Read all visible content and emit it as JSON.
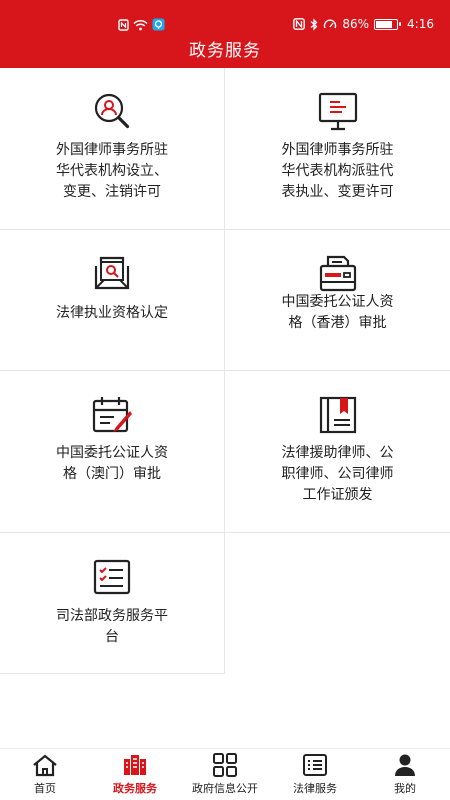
{
  "status_bar": {
    "battery": "86%",
    "time": "4:16",
    "battery_level": 0.86
  },
  "header": {
    "title": "政务服务"
  },
  "services": [
    {
      "label": "外国律师事务所驻\n华代表机构设立、\n变更、注销许可",
      "icon": "person-search-icon"
    },
    {
      "label": "外国律师事务所驻\n华代表机构派驻代\n表执业、变更许可",
      "icon": "monitor-icon"
    },
    {
      "label": "法律执业资格认定",
      "icon": "id-document-icon"
    },
    {
      "label": "中国委托公证人资\n格（香港）审批",
      "icon": "printer-icon"
    },
    {
      "label": "中国委托公证人资\n格（澳门）审批",
      "icon": "calendar-edit-icon"
    },
    {
      "label": "法律援助律师、公\n职律师、公司律师\n工作证颁发",
      "icon": "book-bookmark-icon"
    },
    {
      "label": "司法部政务服务平\n台",
      "icon": "checklist-icon"
    }
  ],
  "tabbar": {
    "tabs": [
      {
        "label": "首页",
        "icon": "home-icon"
      },
      {
        "label": "政务服务",
        "icon": "building-icon",
        "active": true
      },
      {
        "label": "政府信息公开",
        "icon": "grid-icon"
      },
      {
        "label": "法律服务",
        "icon": "list-icon"
      },
      {
        "label": "我的",
        "icon": "user-icon"
      }
    ]
  },
  "colors": {
    "primary": "#d7161c",
    "text": "#222222",
    "divider": "#e6e6e6"
  }
}
